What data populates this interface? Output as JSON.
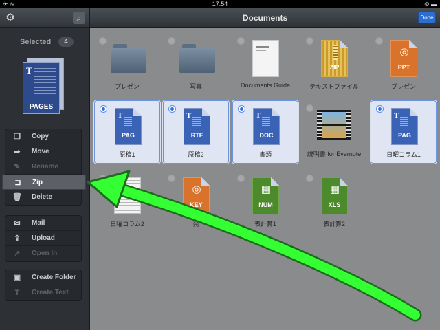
{
  "status": {
    "time": "17:54",
    "left": "✈ ≋",
    "right": "⊙ ▬"
  },
  "sidebar": {
    "selected_label": "Selected",
    "selected_count": "4",
    "preview_label": "PAGES",
    "group1": [
      {
        "label": "Copy",
        "icon": "copy-icon",
        "glyph": "❐",
        "state": "normal"
      },
      {
        "label": "Move",
        "icon": "move-icon",
        "glyph": "➦",
        "state": "normal"
      },
      {
        "label": "Rename",
        "icon": "rename-icon",
        "glyph": "✎",
        "state": "disabled"
      },
      {
        "label": "Zip",
        "icon": "zip-icon",
        "glyph": "⊐",
        "state": "active"
      },
      {
        "label": "Delete",
        "icon": "trash-icon",
        "glyph": "🗑",
        "state": "normal"
      }
    ],
    "group2": [
      {
        "label": "Mail",
        "icon": "mail-icon",
        "glyph": "✉",
        "state": "normal"
      },
      {
        "label": "Upload",
        "icon": "upload-icon",
        "glyph": "⇪",
        "state": "normal"
      },
      {
        "label": "Open In",
        "icon": "open-in-icon",
        "glyph": "↗",
        "state": "disabled"
      }
    ],
    "group3": [
      {
        "label": "Create Folder",
        "icon": "create-folder-icon",
        "glyph": "▣",
        "state": "normal"
      },
      {
        "label": "Create Text",
        "icon": "create-text-icon",
        "glyph": "T",
        "state": "disabled"
      }
    ]
  },
  "nav": {
    "title": "Documents",
    "done": "Done"
  },
  "items": [
    {
      "name": "プレゼン",
      "kind": "folder",
      "selected": false
    },
    {
      "name": "写真",
      "kind": "folder",
      "selected": false
    },
    {
      "name": "Documents Guide",
      "kind": "plain",
      "selected": false
    },
    {
      "name": "テキストファイル",
      "kind": "zip",
      "ext": "ZIP",
      "selected": false
    },
    {
      "name": "プレゼン",
      "kind": "orange",
      "ext": "PPT",
      "selected": false
    },
    {
      "name": "原稿1",
      "kind": "blue",
      "ext": "PAG",
      "selected": true
    },
    {
      "name": "原稿2",
      "kind": "blue",
      "ext": "RTF",
      "selected": true
    },
    {
      "name": "書類",
      "kind": "blue",
      "ext": "DOC",
      "selected": true
    },
    {
      "name": "説明書 for Evernote",
      "kind": "film",
      "selected": false
    },
    {
      "name": "日曜コラム1",
      "kind": "blue",
      "ext": "PAG",
      "selected": true
    },
    {
      "name": "日曜コラム2",
      "kind": "lined",
      "selected": false
    },
    {
      "name": "発",
      "kind": "orange",
      "ext": "KEY",
      "selected": false
    },
    {
      "name": "表計算1",
      "kind": "green",
      "ext": "NUM",
      "selected": false
    },
    {
      "name": "表計算2",
      "kind": "green",
      "ext": "XLS",
      "selected": false
    }
  ],
  "colors": {
    "accent": "#2f6fe2",
    "arrow": "#33ff33",
    "sidebar": "#2d3034"
  }
}
